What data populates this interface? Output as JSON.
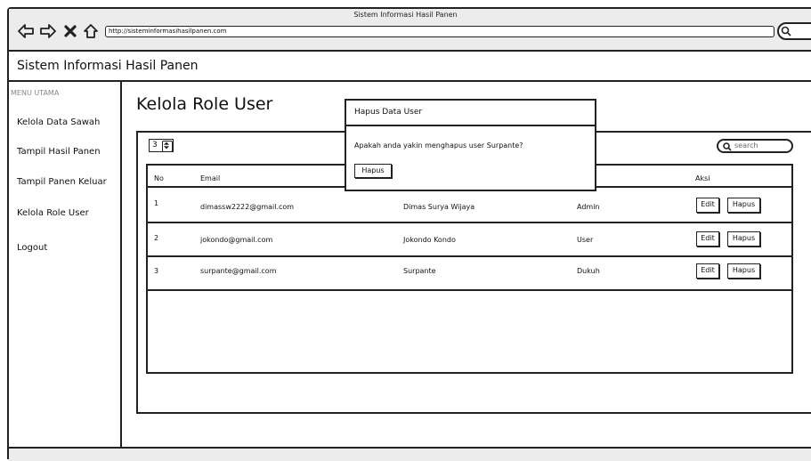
{
  "browser": {
    "window_title": "Sistem Informasi Hasil Panen",
    "url": "http://sisteminformasihasilpanen.com"
  },
  "app": {
    "title": "Sistem Informasi Hasil Panen"
  },
  "sidebar": {
    "caption": "MENU UTAMA",
    "items": [
      {
        "label": "Kelola Data Sawah"
      },
      {
        "label": "Tampil Hasil Panen"
      },
      {
        "label": "Tampil Panen Keluar"
      },
      {
        "label": "Kelola Role User"
      },
      {
        "label": "Logout"
      }
    ]
  },
  "main": {
    "title": "Kelola Role User",
    "page_size": "3",
    "search_placeholder": "search",
    "columns": [
      "No",
      "Email",
      "",
      "",
      "Aksi"
    ],
    "rows": [
      {
        "no": "1",
        "email": "dimassw2222@gmail.com",
        "name": "Dimas Surya Wijaya",
        "role": "Admin",
        "edit": "Edit",
        "delete": "Hapus"
      },
      {
        "no": "2",
        "email": "jokondo@gmail.com",
        "name": "Jokondo Kondo",
        "role": "User",
        "edit": "Edit",
        "delete": "Hapus"
      },
      {
        "no": "3",
        "email": "surpante@gmail.com",
        "name": "Surpante",
        "role": "Dukuh",
        "edit": "Edit",
        "delete": "Hapus"
      }
    ]
  },
  "dialog": {
    "title": "Hapus Data User",
    "message": "Apakah anda yakin menghapus user Surpante?",
    "confirm_label": "Hapus"
  }
}
